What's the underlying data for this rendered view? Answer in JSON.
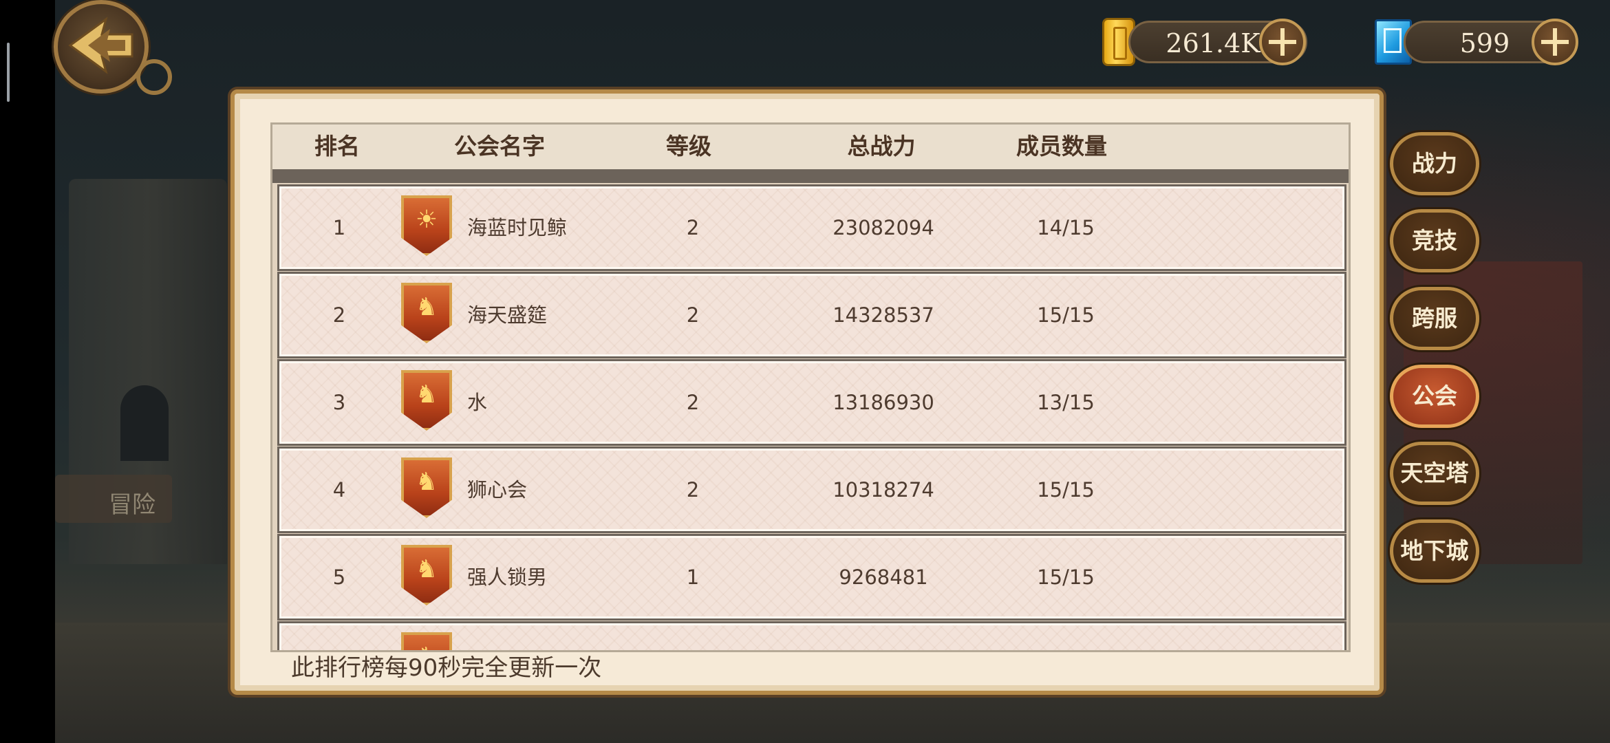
{
  "currency": {
    "gold_icon": "gold-bar-icon",
    "gold_value": "261.4K",
    "gem_icon": "blue-gem-icon",
    "gem_value": "599"
  },
  "table": {
    "headers": {
      "rank": "排名",
      "guild_name": "公会名字",
      "level": "等级",
      "total_power": "总战力",
      "members": "成员数量"
    },
    "rows": [
      {
        "rank": "1",
        "emblem": "sun-emblem-icon",
        "name": "海蓝时见鲸",
        "level": "2",
        "power": "23082094",
        "members": "14/15"
      },
      {
        "rank": "2",
        "emblem": "dragon-emblem-icon",
        "name": "海天盛筵",
        "level": "2",
        "power": "14328537",
        "members": "15/15"
      },
      {
        "rank": "3",
        "emblem": "dragon-emblem-icon",
        "name": "水",
        "level": "2",
        "power": "13186930",
        "members": "13/15"
      },
      {
        "rank": "4",
        "emblem": "dragon-emblem-icon",
        "name": "狮心会",
        "level": "2",
        "power": "10318274",
        "members": "15/15"
      },
      {
        "rank": "5",
        "emblem": "dragon-emblem-icon",
        "name": "强人锁男",
        "level": "1",
        "power": "9268481",
        "members": "15/15"
      }
    ]
  },
  "footer_note": "此排行榜每90秒完全更新一次",
  "side_tabs": [
    {
      "label": "战力",
      "active": false
    },
    {
      "label": "竞技",
      "active": false
    },
    {
      "label": "跨服",
      "active": false
    },
    {
      "label": "公会",
      "active": true
    },
    {
      "label": "天空塔",
      "active": false
    },
    {
      "label": "地下城",
      "active": false
    }
  ],
  "background": {
    "sign_text": "冒险"
  }
}
